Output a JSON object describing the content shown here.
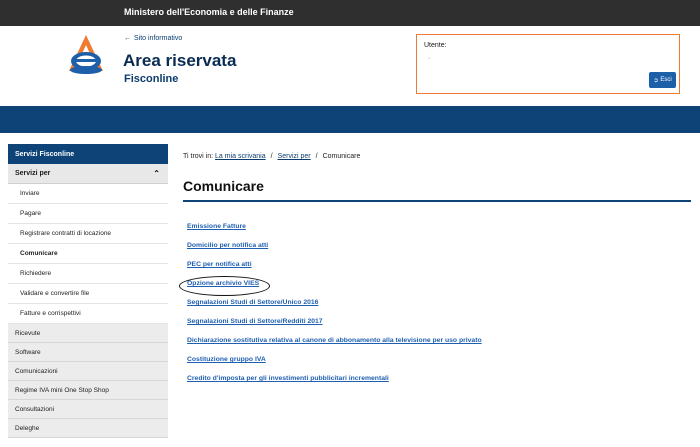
{
  "topbar": {
    "ministry": "Ministero dell'Economia e delle Finanze"
  },
  "header": {
    "back_link": "Sito informativo",
    "title": "Area riservata",
    "subtitle": "Fisconline"
  },
  "user_box": {
    "label": "Utente:",
    "value": "·",
    "logout_label": "Esci"
  },
  "sidebar": {
    "header": "Servizi Fisconline",
    "group_label": "Servizi per",
    "subitems": [
      {
        "label": "Inviare"
      },
      {
        "label": "Pagare"
      },
      {
        "label": "Registrare contratti di locazione"
      },
      {
        "label": "Comunicare"
      },
      {
        "label": "Richiedere"
      },
      {
        "label": "Validare e convertire file"
      },
      {
        "label": "Fatture e corrispettivi"
      }
    ],
    "items": [
      {
        "label": "Ricevute"
      },
      {
        "label": "Software"
      },
      {
        "label": "Comunicazioni"
      },
      {
        "label": "Regime IVA mini One Stop Shop"
      },
      {
        "label": "Consultazioni"
      },
      {
        "label": "Deleghe"
      }
    ]
  },
  "breadcrumb": {
    "prefix": "Ti trovi in:",
    "items": [
      "La mia scrivania",
      "Servizi per",
      "Comunicare"
    ]
  },
  "main": {
    "title": "Comunicare",
    "links": [
      "Emissione Fatture",
      "Domicilio per notifica atti",
      "PEC per notifica atti",
      "Opzione archivio VIES",
      "Segnalazioni Studi di Settore/Unico 2016",
      "Segnalazioni Studi di Settore/Redditi 2017",
      "Dichiarazione sostitutiva relativa al canone di abbonamento alla televisione per uso privato",
      "Costituzione gruppo IVA",
      "Credito d'imposta per gli investimenti pubblicitari incrementali"
    ]
  },
  "colors": {
    "navy": "#0e4378",
    "accent_orange": "#f07a30",
    "link_blue": "#1f5fb0",
    "button_blue": "#1d5fa8"
  }
}
